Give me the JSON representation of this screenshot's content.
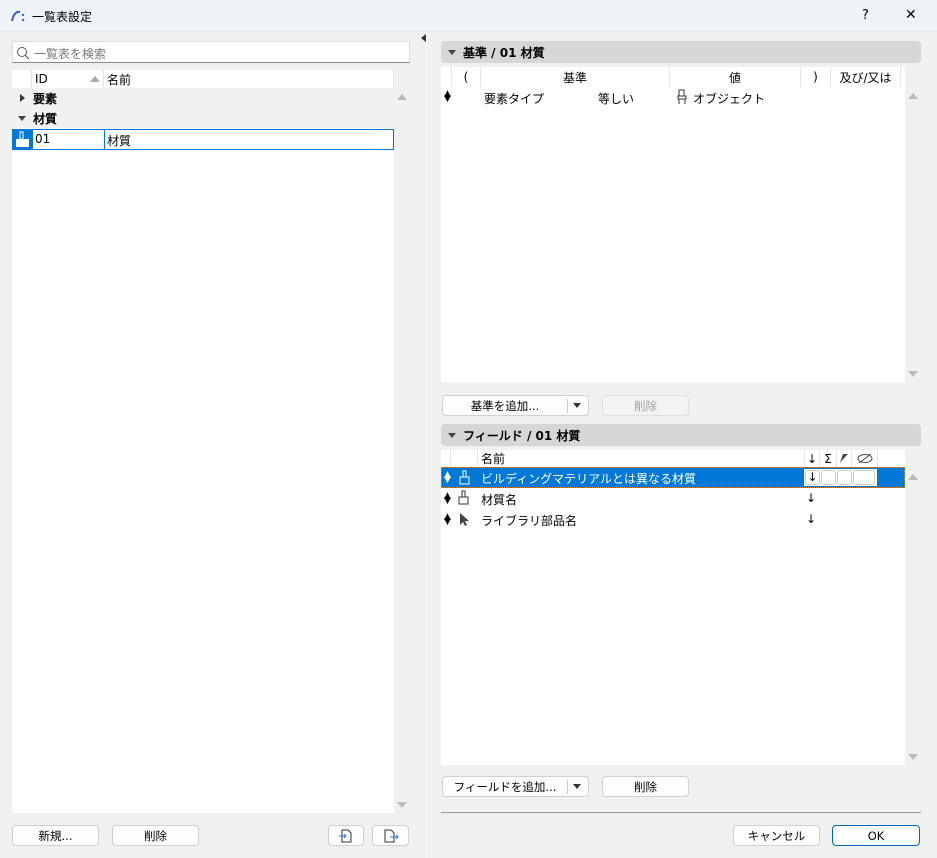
{
  "window": {
    "title": "一覧表設定",
    "help": "?",
    "close": "✕"
  },
  "left": {
    "search_placeholder": "一覧表を検索",
    "columns": {
      "id": "ID",
      "name": "名前"
    },
    "groups": [
      {
        "label": "要素",
        "expanded": false
      },
      {
        "label": "材質",
        "expanded": true
      }
    ],
    "selected_row": {
      "id": "01",
      "name": "材質"
    },
    "buttons": {
      "new": "新規...",
      "delete": "削除"
    }
  },
  "criteria": {
    "title": "基準 / 01 材質",
    "columns": {
      "open": "(",
      "criterion": "基準",
      "value": "値",
      "close": ")",
      "andor": "及び/又は"
    },
    "rows": [
      {
        "criterion": "要素タイプ",
        "operator": "等しい",
        "value": "オブジェクト"
      }
    ],
    "add_button": "基準を追加...",
    "delete_button": "削除"
  },
  "fields": {
    "title": "フィールド / 01 材質",
    "columns": {
      "name": "名前",
      "sort": "↓",
      "sum": "Σ"
    },
    "rows": [
      {
        "name": "ビルディングマテリアルとは異なる材質",
        "icon": "brush",
        "sort": "↓"
      },
      {
        "name": "材質名",
        "icon": "brush",
        "sort": "↓"
      },
      {
        "name": "ライブラリ部品名",
        "icon": "cursor",
        "sort": "↓"
      }
    ],
    "add_button": "フィールドを追加...",
    "delete_button": "削除"
  },
  "footer": {
    "cancel": "キャンセル",
    "ok": "OK"
  },
  "colors": {
    "accent": "#0078d7",
    "section": "#d6d6d6"
  }
}
